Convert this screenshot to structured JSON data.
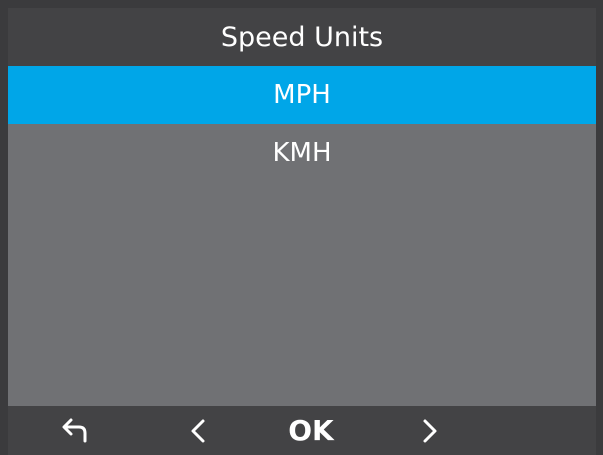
{
  "title": "Speed Units",
  "menu": {
    "items": [
      {
        "label": "MPH",
        "selected": true
      },
      {
        "label": "KMH",
        "selected": false
      }
    ]
  },
  "footer": {
    "back_icon": "back-arrow-icon",
    "prev_icon": "chevron-left-icon",
    "ok_label": "OK",
    "next_icon": "chevron-right-icon"
  },
  "colors": {
    "selection": "#00a6e8",
    "panel": "#707174",
    "bar": "#434345"
  }
}
